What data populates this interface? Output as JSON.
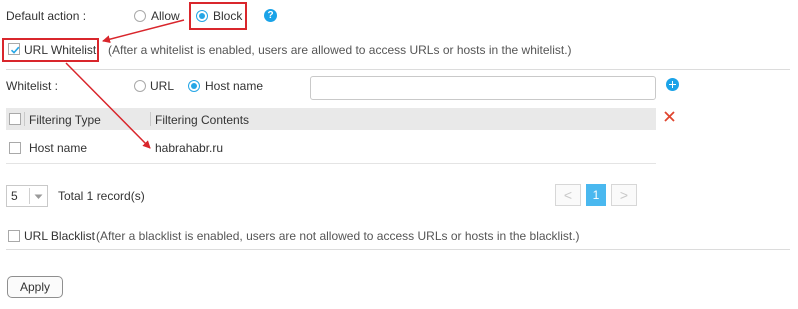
{
  "default_action": {
    "label": "Default action :",
    "options": [
      "Allow",
      "Block"
    ],
    "selected": "Block"
  },
  "url_whitelist": {
    "label": "URL Whitelist",
    "checked": true,
    "note": "(After a whitelist is enabled, users are allowed to access URLs or hosts in the whitelist.)"
  },
  "whitelist": {
    "label": "Whitelist :",
    "options": [
      "URL",
      "Host name"
    ],
    "selected": "Host name",
    "input_value": ""
  },
  "table": {
    "headers": [
      "Filtering Type",
      "Filtering Contents"
    ],
    "rows": [
      {
        "type": "Host name",
        "contents": "habrahabr.ru"
      }
    ]
  },
  "pagination": {
    "page_size": "5",
    "total": "Total 1 record(s)",
    "current_page": "1",
    "prev": "<",
    "next": ">"
  },
  "url_blacklist": {
    "label": "URL Blacklist",
    "checked": false,
    "note": "(After a blacklist is enabled, users are not allowed to access URLs or hosts in the blacklist.)"
  },
  "help_glyph": "?",
  "apply_label": "Apply",
  "icons": {
    "help": "help-icon",
    "add": "add-icon",
    "delete": "delete-icon",
    "dropdown": "caret-down-icon"
  },
  "colors": {
    "accent": "#1aa3e8",
    "annotation": "#d9262c",
    "delete": "#e0452f",
    "header_bg": "#e9e9e9"
  }
}
